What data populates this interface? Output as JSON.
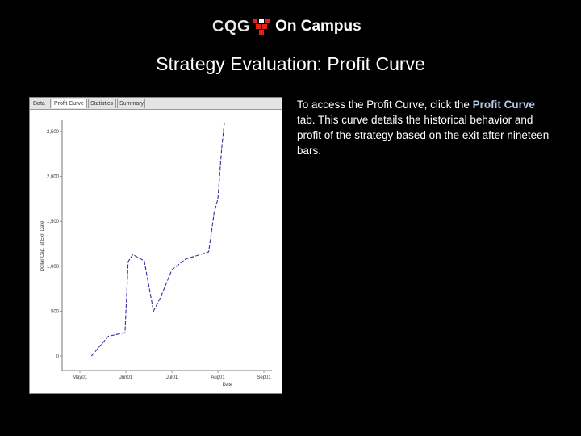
{
  "brand": {
    "cqg": "CQG",
    "on_campus": "On Campus",
    "mark_colors": [
      "#e2231a",
      "#ffffff"
    ]
  },
  "slide_title": "Strategy Evaluation: Profit Curve",
  "screenshot": {
    "tabs": [
      {
        "label": "Data",
        "active": false
      },
      {
        "label": "Profit Curve",
        "active": true
      },
      {
        "label": "Statistics",
        "active": false
      },
      {
        "label": "Summary",
        "active": false
      }
    ],
    "ylabel": "Dollar Cap. at Exit Date",
    "xlabel": "Date"
  },
  "description": {
    "before": "To access the Profit Curve, click the ",
    "highlight": "Profit Curve",
    "after": " tab. This curve details the historical behavior and profit of the strategy based on the exit after nineteen bars."
  },
  "chart_data": {
    "type": "line",
    "xlabel": "Date",
    "ylabel": "Dollar Cap. at Exit Date",
    "x_ticks": [
      "May01",
      "Jun01",
      "Jul01",
      "Aug01",
      "Sep01"
    ],
    "y_ticks": [
      "2,500",
      "2,000",
      "1,500",
      "1,000",
      "500",
      "0"
    ],
    "ylim": [
      0,
      2500
    ],
    "series": [
      {
        "color": "#3030a0",
        "x": [
          0.25,
          0.62,
          0.98,
          1.05,
          1.15,
          1.4,
          1.6,
          1.75,
          2.0,
          2.3,
          2.8,
          2.92,
          3.0,
          3.08,
          3.14
        ],
        "y": [
          0,
          220,
          260,
          1050,
          1130,
          1060,
          500,
          650,
          960,
          1080,
          1160,
          1600,
          1750,
          2300,
          2600
        ]
      }
    ],
    "grid": false
  }
}
